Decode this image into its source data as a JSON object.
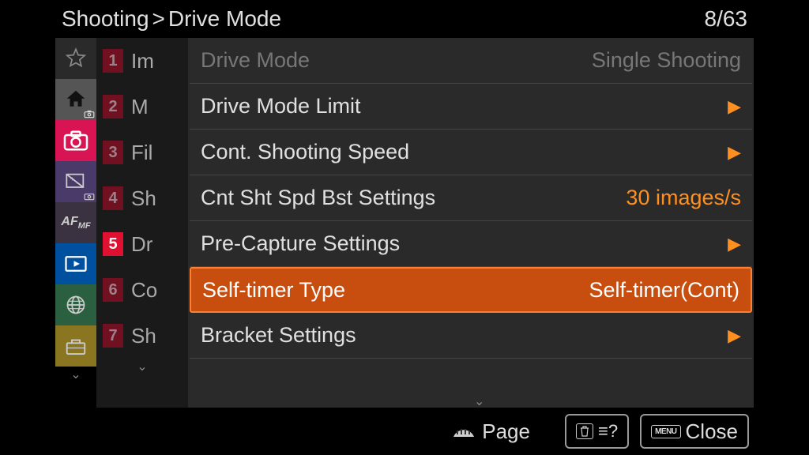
{
  "header": {
    "breadcrumb_parent": "Shooting",
    "breadcrumb_sep": ">",
    "breadcrumb_child": "Drive Mode",
    "page_indicator": "8/63"
  },
  "sidebar_list": [
    {
      "num": "1",
      "label": "Im",
      "active": false
    },
    {
      "num": "2",
      "label": "M",
      "active": false
    },
    {
      "num": "3",
      "label": "Fil",
      "active": false
    },
    {
      "num": "4",
      "label": "Sh",
      "active": false
    },
    {
      "num": "5",
      "label": "Dr",
      "active": true
    },
    {
      "num": "6",
      "label": "Co",
      "active": false
    },
    {
      "num": "7",
      "label": "Sh",
      "active": false
    }
  ],
  "menu": [
    {
      "label": "Drive Mode",
      "value": "Single Shooting",
      "type": "disabled"
    },
    {
      "label": "Drive Mode Limit",
      "value": "",
      "type": "chevron"
    },
    {
      "label": "Cont. Shooting Speed",
      "value": "",
      "type": "chevron"
    },
    {
      "label": "Cnt Sht Spd Bst Settings",
      "value": "30 images/s",
      "type": "value"
    },
    {
      "label": "Pre-Capture Settings",
      "value": "",
      "type": "chevron"
    },
    {
      "label": "Self-timer Type",
      "value": "Self-timer(Cont)",
      "type": "highlighted"
    },
    {
      "label": "Bracket Settings",
      "value": "",
      "type": "chevron"
    }
  ],
  "footer": {
    "page_label": "Page",
    "help_label": "?",
    "close_prefix": "MENU",
    "close_label": "Close"
  }
}
